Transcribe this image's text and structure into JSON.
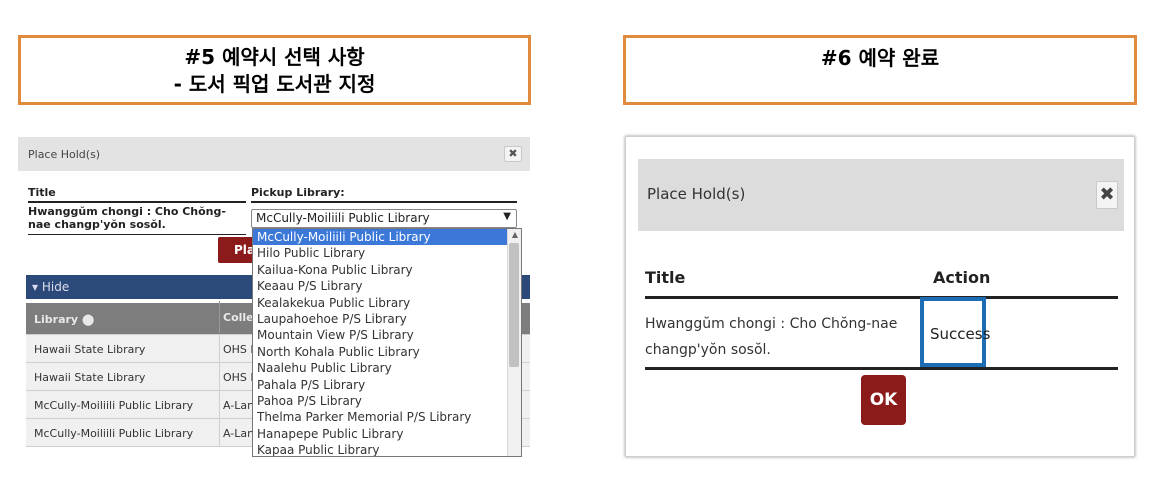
{
  "step5": {
    "title_line1": "#5 예약시 선택 사항",
    "title_line2": "- 도서 픽업 도서관 지정",
    "modal_title": "Place Hold(s)",
    "close_glyph": "✖",
    "col_title": "Title",
    "col_pickup": "Pickup Library:",
    "book_title": "Hwanggŭm chongi : Cho Chŏng-nae changp'yŏn sosŏl.",
    "selected_library": "McCully-Moiliili Public Library",
    "place_button_partial": "Pla",
    "hide_label": "▾ Hide",
    "table_header": {
      "library": "Library",
      "collection": "Collec"
    },
    "table_rows": [
      {
        "library": "Hawaii State Library",
        "collection": "OHS L"
      },
      {
        "library": "Hawaii State Library",
        "collection": "OHS L"
      },
      {
        "library": "McCully-Moiliili Public Library",
        "collection": "A-Lan"
      },
      {
        "library": "McCully-Moiliili Public Library",
        "collection": "A-Lan"
      }
    ],
    "dropdown_options": [
      "McCully-Moiliili Public Library",
      "Hilo Public Library",
      "Kailua-Kona Public Library",
      "Keaau P/S Library",
      "Kealakekua Public Library",
      "Laupahoehoe P/S Library",
      "Mountain View P/S Library",
      "North Kohala Public Library",
      "Naalehu Public Library",
      "Pahala P/S Library",
      "Pahoa P/S Library",
      "Thelma Parker Memorial P/S Library",
      "Hanapepe Public Library",
      "Kapaa Public Library"
    ]
  },
  "step6": {
    "title": "#6 예약 완료",
    "modal_title": "Place Hold(s)",
    "close_glyph": "✖",
    "col_title": "Title",
    "col_action": "Action",
    "book_title": "Hwanggŭm chongi : Cho Chŏng-nae changp'yŏn sosŏl.",
    "status": "Success",
    "ok_label": "OK"
  },
  "colors": {
    "step_border": "#e08a3c",
    "button_red": "#8b1a1a",
    "dropdown_selected": "#3b78d8",
    "highlight_blue": "#1d6db5"
  }
}
